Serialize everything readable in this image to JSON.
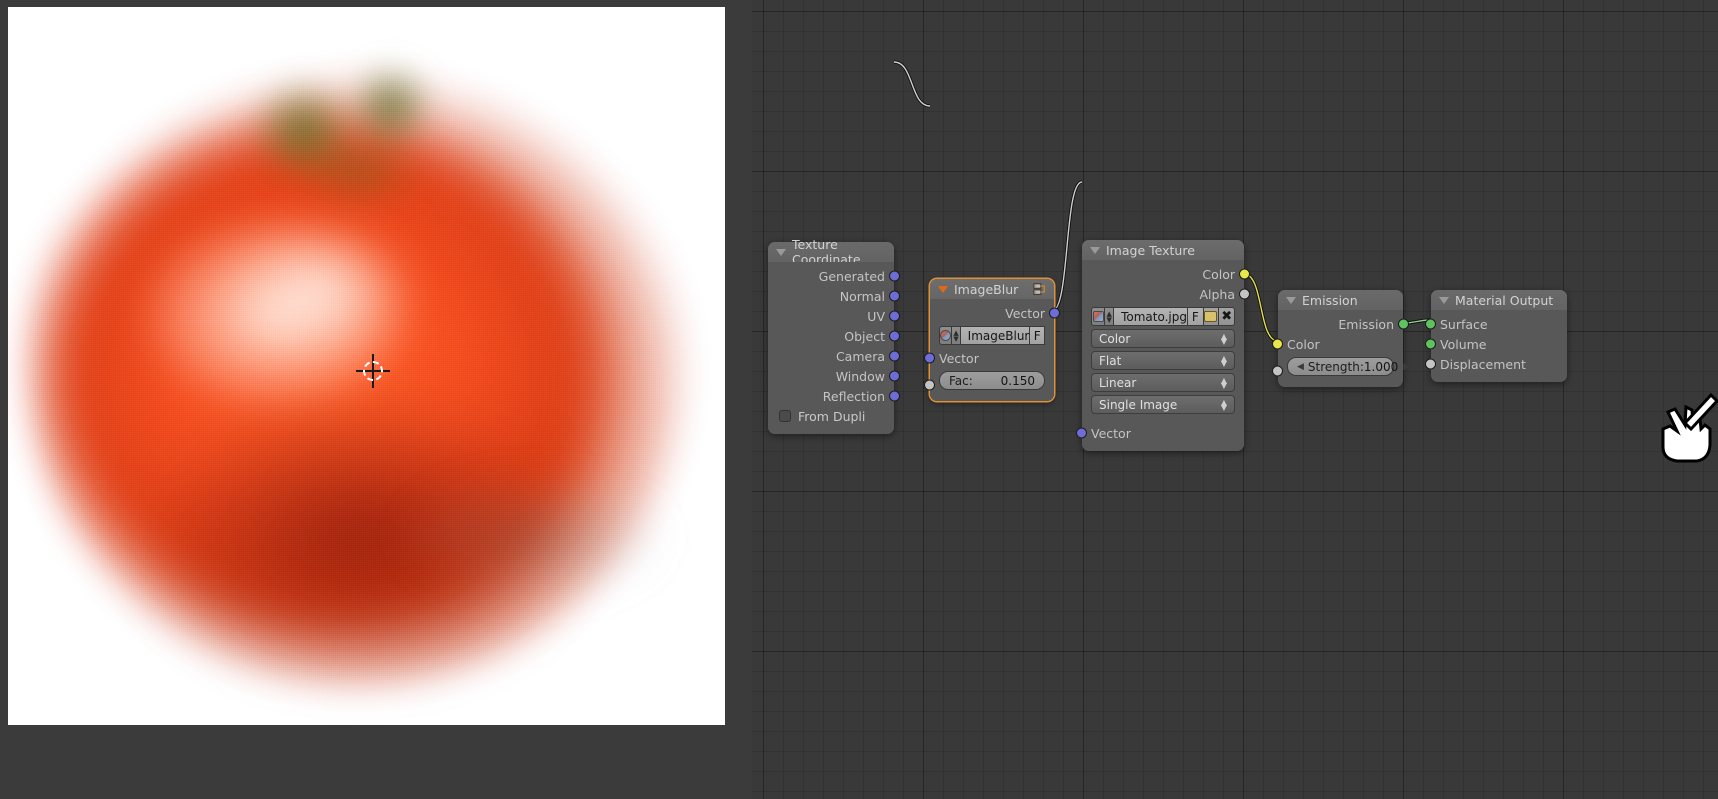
{
  "app": {
    "editor": "blender-shader-node-editor",
    "viewport_label": "render-result"
  },
  "render": {
    "subject": "tomato",
    "background_color": "#ffffff",
    "cursor_marker": "3d-cursor"
  },
  "nodes": {
    "texture_coordinate": {
      "title": "Texture Coordinate",
      "outputs": [
        "Generated",
        "Normal",
        "UV",
        "Object",
        "Camera",
        "Window",
        "Reflection"
      ],
      "checkbox_label": "From Dupli",
      "checkbox_checked": false,
      "socket_color": "#6d6dd8"
    },
    "image_blur": {
      "title": "ImageBlur",
      "outputs": [
        "Vector"
      ],
      "group_name": "ImageBlur",
      "group_users_flag": "F",
      "inputs": [
        "Vector"
      ],
      "value_label": "Fac:",
      "value": "0.150",
      "selected": true,
      "header_accent": "#e06a14"
    },
    "image_texture": {
      "title": "Image Texture",
      "outputs": [
        "Color",
        "Alpha"
      ],
      "image_name": "Tomato.jpg",
      "image_users_flag": "F",
      "dropdowns": [
        "Color",
        "Flat",
        "Linear",
        "Single Image"
      ],
      "inputs": [
        "Vector"
      ],
      "color_socket": "#e8e84a",
      "alpha_socket": "#c3c3c3"
    },
    "emission": {
      "title": "Emission",
      "outputs": [
        "Emission"
      ],
      "inputs": [
        "Color",
        "Strength"
      ],
      "strength_label": "Strength:",
      "strength_value": "1.000",
      "shader_socket": "#5ec25e"
    },
    "material_output": {
      "title": "Material Output",
      "inputs": [
        "Surface",
        "Volume",
        "Displacement"
      ],
      "surface_socket": "#5ec25e",
      "volume_socket": "#5ec25e",
      "displacement_socket": "#c3c3c3"
    }
  },
  "cursor": {
    "type": "grab-hand-cursor"
  }
}
